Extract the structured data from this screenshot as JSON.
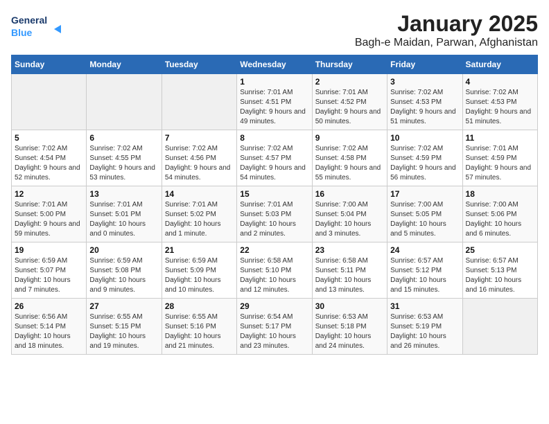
{
  "logo": {
    "line1": "General",
    "line2": "Blue"
  },
  "title": "January 2025",
  "subtitle": "Bagh-e Maidan, Parwan, Afghanistan",
  "days_of_week": [
    "Sunday",
    "Monday",
    "Tuesday",
    "Wednesday",
    "Thursday",
    "Friday",
    "Saturday"
  ],
  "weeks": [
    [
      {
        "day": "",
        "info": ""
      },
      {
        "day": "",
        "info": ""
      },
      {
        "day": "",
        "info": ""
      },
      {
        "day": "1",
        "info": "Sunrise: 7:01 AM\nSunset: 4:51 PM\nDaylight: 9 hours and 49 minutes."
      },
      {
        "day": "2",
        "info": "Sunrise: 7:01 AM\nSunset: 4:52 PM\nDaylight: 9 hours and 50 minutes."
      },
      {
        "day": "3",
        "info": "Sunrise: 7:02 AM\nSunset: 4:53 PM\nDaylight: 9 hours and 51 minutes."
      },
      {
        "day": "4",
        "info": "Sunrise: 7:02 AM\nSunset: 4:53 PM\nDaylight: 9 hours and 51 minutes."
      }
    ],
    [
      {
        "day": "5",
        "info": "Sunrise: 7:02 AM\nSunset: 4:54 PM\nDaylight: 9 hours and 52 minutes."
      },
      {
        "day": "6",
        "info": "Sunrise: 7:02 AM\nSunset: 4:55 PM\nDaylight: 9 hours and 53 minutes."
      },
      {
        "day": "7",
        "info": "Sunrise: 7:02 AM\nSunset: 4:56 PM\nDaylight: 9 hours and 54 minutes."
      },
      {
        "day": "8",
        "info": "Sunrise: 7:02 AM\nSunset: 4:57 PM\nDaylight: 9 hours and 54 minutes."
      },
      {
        "day": "9",
        "info": "Sunrise: 7:02 AM\nSunset: 4:58 PM\nDaylight: 9 hours and 55 minutes."
      },
      {
        "day": "10",
        "info": "Sunrise: 7:02 AM\nSunset: 4:59 PM\nDaylight: 9 hours and 56 minutes."
      },
      {
        "day": "11",
        "info": "Sunrise: 7:01 AM\nSunset: 4:59 PM\nDaylight: 9 hours and 57 minutes."
      }
    ],
    [
      {
        "day": "12",
        "info": "Sunrise: 7:01 AM\nSunset: 5:00 PM\nDaylight: 9 hours and 59 minutes."
      },
      {
        "day": "13",
        "info": "Sunrise: 7:01 AM\nSunset: 5:01 PM\nDaylight: 10 hours and 0 minutes."
      },
      {
        "day": "14",
        "info": "Sunrise: 7:01 AM\nSunset: 5:02 PM\nDaylight: 10 hours and 1 minute."
      },
      {
        "day": "15",
        "info": "Sunrise: 7:01 AM\nSunset: 5:03 PM\nDaylight: 10 hours and 2 minutes."
      },
      {
        "day": "16",
        "info": "Sunrise: 7:00 AM\nSunset: 5:04 PM\nDaylight: 10 hours and 3 minutes."
      },
      {
        "day": "17",
        "info": "Sunrise: 7:00 AM\nSunset: 5:05 PM\nDaylight: 10 hours and 5 minutes."
      },
      {
        "day": "18",
        "info": "Sunrise: 7:00 AM\nSunset: 5:06 PM\nDaylight: 10 hours and 6 minutes."
      }
    ],
    [
      {
        "day": "19",
        "info": "Sunrise: 6:59 AM\nSunset: 5:07 PM\nDaylight: 10 hours and 7 minutes."
      },
      {
        "day": "20",
        "info": "Sunrise: 6:59 AM\nSunset: 5:08 PM\nDaylight: 10 hours and 9 minutes."
      },
      {
        "day": "21",
        "info": "Sunrise: 6:59 AM\nSunset: 5:09 PM\nDaylight: 10 hours and 10 minutes."
      },
      {
        "day": "22",
        "info": "Sunrise: 6:58 AM\nSunset: 5:10 PM\nDaylight: 10 hours and 12 minutes."
      },
      {
        "day": "23",
        "info": "Sunrise: 6:58 AM\nSunset: 5:11 PM\nDaylight: 10 hours and 13 minutes."
      },
      {
        "day": "24",
        "info": "Sunrise: 6:57 AM\nSunset: 5:12 PM\nDaylight: 10 hours and 15 minutes."
      },
      {
        "day": "25",
        "info": "Sunrise: 6:57 AM\nSunset: 5:13 PM\nDaylight: 10 hours and 16 minutes."
      }
    ],
    [
      {
        "day": "26",
        "info": "Sunrise: 6:56 AM\nSunset: 5:14 PM\nDaylight: 10 hours and 18 minutes."
      },
      {
        "day": "27",
        "info": "Sunrise: 6:55 AM\nSunset: 5:15 PM\nDaylight: 10 hours and 19 minutes."
      },
      {
        "day": "28",
        "info": "Sunrise: 6:55 AM\nSunset: 5:16 PM\nDaylight: 10 hours and 21 minutes."
      },
      {
        "day": "29",
        "info": "Sunrise: 6:54 AM\nSunset: 5:17 PM\nDaylight: 10 hours and 23 minutes."
      },
      {
        "day": "30",
        "info": "Sunrise: 6:53 AM\nSunset: 5:18 PM\nDaylight: 10 hours and 24 minutes."
      },
      {
        "day": "31",
        "info": "Sunrise: 6:53 AM\nSunset: 5:19 PM\nDaylight: 10 hours and 26 minutes."
      },
      {
        "day": "",
        "info": ""
      }
    ]
  ]
}
